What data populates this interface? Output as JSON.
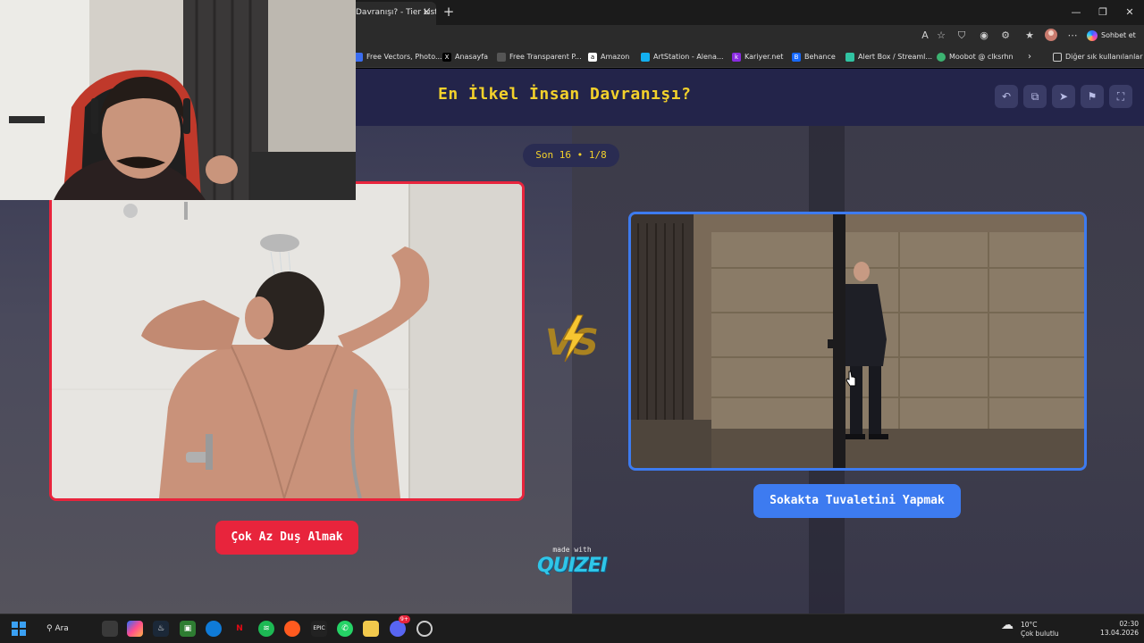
{
  "browser": {
    "tab_title": "Davranışı? - Tier List",
    "tab_close": "✕",
    "new_tab": "+",
    "window": {
      "minimize": "—",
      "restore": "❐",
      "close": "✕"
    },
    "copilot_label": "Sohbet et",
    "bookmarks": [
      {
        "label": "Free Vectors, Photo...",
        "icon": "freepik-icon",
        "color": "#3b6df0"
      },
      {
        "label": "Anasayfa",
        "icon": "x-icon",
        "color": "#000000"
      },
      {
        "label": "Free Transparent P...",
        "icon": "pngtree-icon",
        "color": "#555555"
      },
      {
        "label": "Amazon",
        "icon": "amazon-icon",
        "color": "#ffffff"
      },
      {
        "label": "ArtStation - Alena...",
        "icon": "artstation-icon",
        "color": "#13aff0"
      },
      {
        "label": "Kariyer.net",
        "icon": "kariyer-icon",
        "color": "#8a2be2"
      },
      {
        "label": "Behance",
        "icon": "behance-icon",
        "color": "#1769ff"
      },
      {
        "label": "Alert Box / Streaml...",
        "icon": "streamlabs-icon",
        "color": "#31c3a2"
      },
      {
        "label": "Moobot @ clksrhn",
        "icon": "moobot-icon",
        "color": "#3cb371"
      }
    ],
    "other_bookmarks": "Diğer sık kullanılanlar"
  },
  "quiz": {
    "title": "En İlkel İnsan Davranışı?",
    "round": "Son 16 • 1/8",
    "left_choice": "Çok Az Duş Almak",
    "right_choice": "Sokakta Tuvaletini Yapmak",
    "vs": "VS",
    "made_with": "made with",
    "brand": "QUIZEI",
    "accent_left": "#e8243c",
    "accent_right": "#3d7bf0",
    "title_color": "#f3d12b"
  },
  "taskbar": {
    "search": "Ara",
    "weather_temp": "10°C",
    "weather_desc": "Çok bulutlu",
    "time": "02:30",
    "date": "13.04.2026",
    "discord_badge": "9+"
  }
}
